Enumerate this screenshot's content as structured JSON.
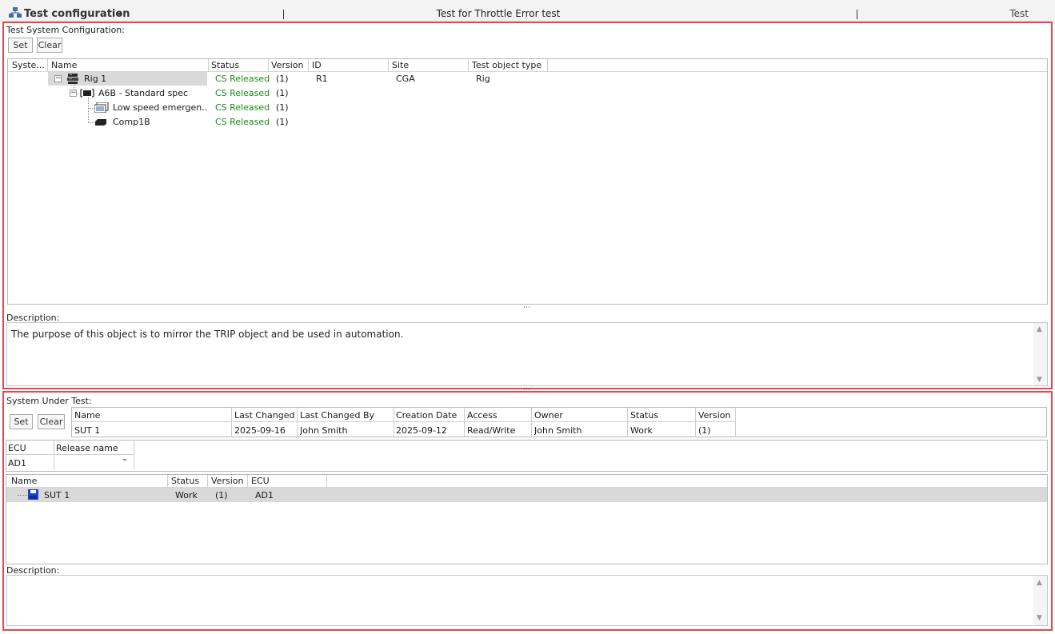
{
  "header": {
    "title": "Test configuration",
    "center_text": "Test for Throttle Error test",
    "right_text": "Test"
  },
  "tsc": {
    "label": "Test System Configuration:",
    "set_label": "Set",
    "clear_label": "Clear",
    "columns": [
      "Syste...",
      "Name",
      "Status",
      "Version",
      "ID",
      "Site",
      "Test object type"
    ],
    "rows": [
      {
        "name": "Rig 1",
        "status": "CS Released",
        "version": "(1)",
        "id": "R1",
        "site": "CGA",
        "type": "Rig",
        "icon": "rig-icon"
      },
      {
        "name": "A6B - Standard spec",
        "status": "CS Released",
        "version": "(1)",
        "id": "",
        "site": "",
        "type": "",
        "icon": "ecu-icon"
      },
      {
        "name": "Low speed emergen...",
        "status": "CS Released",
        "version": "(1)",
        "id": "",
        "site": "",
        "type": "",
        "icon": "list-icon"
      },
      {
        "name": "Comp1B",
        "status": "CS Released",
        "version": "(1)",
        "id": "",
        "site": "",
        "type": "",
        "icon": "component-icon"
      }
    ],
    "description_label": "Description:",
    "description": "The purpose of this object is to mirror the TRIP object and be used in automation."
  },
  "sut": {
    "label": "System Under Test:",
    "set_label": "Set",
    "clear_label": "Clear",
    "info_columns": [
      "Name",
      "Last Changed",
      "Last Changed By",
      "Creation Date",
      "Access",
      "Owner",
      "Status",
      "Version"
    ],
    "info_values": [
      "SUT 1",
      "2025-09-16",
      "John Smith",
      "2025-09-12",
      "Read/Write",
      "John Smith",
      "Work",
      "(1)"
    ],
    "ecu_columns": [
      "ECU",
      "Release name"
    ],
    "ecu_values": [
      "AD1",
      ""
    ],
    "list_columns": [
      "Name",
      "Status",
      "Version",
      "ECU"
    ],
    "list_rows": [
      {
        "name": "SUT 1",
        "status": "Work",
        "version": "(1)",
        "ecu": "AD1",
        "icon": "sut-icon"
      }
    ],
    "description_label": "Description:",
    "description": ""
  },
  "colors": {
    "frame": "#e8474f",
    "released": "#1b8a1b",
    "selection": "#d9d9d9"
  }
}
